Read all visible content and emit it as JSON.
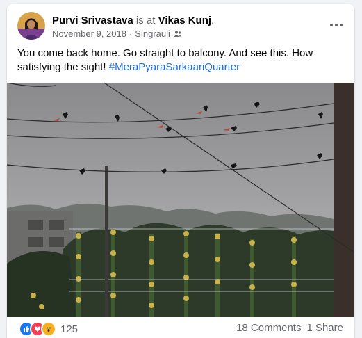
{
  "post": {
    "author": "Purvi Srivastava",
    "connector": "is at",
    "place": "Vikas Kunj",
    "place_suffix": ".",
    "date": "November 9, 2018",
    "separator": "·",
    "location": "Singrauli",
    "audience_icon": "friends-icon",
    "more_icon": "more-options-icon",
    "text": "You come back home. Go straight to balcony. And see this. How satisfying the sight! ",
    "hashtag": "#MeraPyaraSarkaariQuarter"
  },
  "footer": {
    "reactions": [
      "like-icon",
      "love-icon",
      "wow-icon"
    ],
    "reaction_count": "125",
    "comments": "18 Comments",
    "shares": "1 Share"
  },
  "colors": {
    "link": "#216fdb",
    "secondary_text": "#65676b",
    "like": "#1877f2",
    "love": "#f33e58",
    "wow": "#f7b125"
  }
}
